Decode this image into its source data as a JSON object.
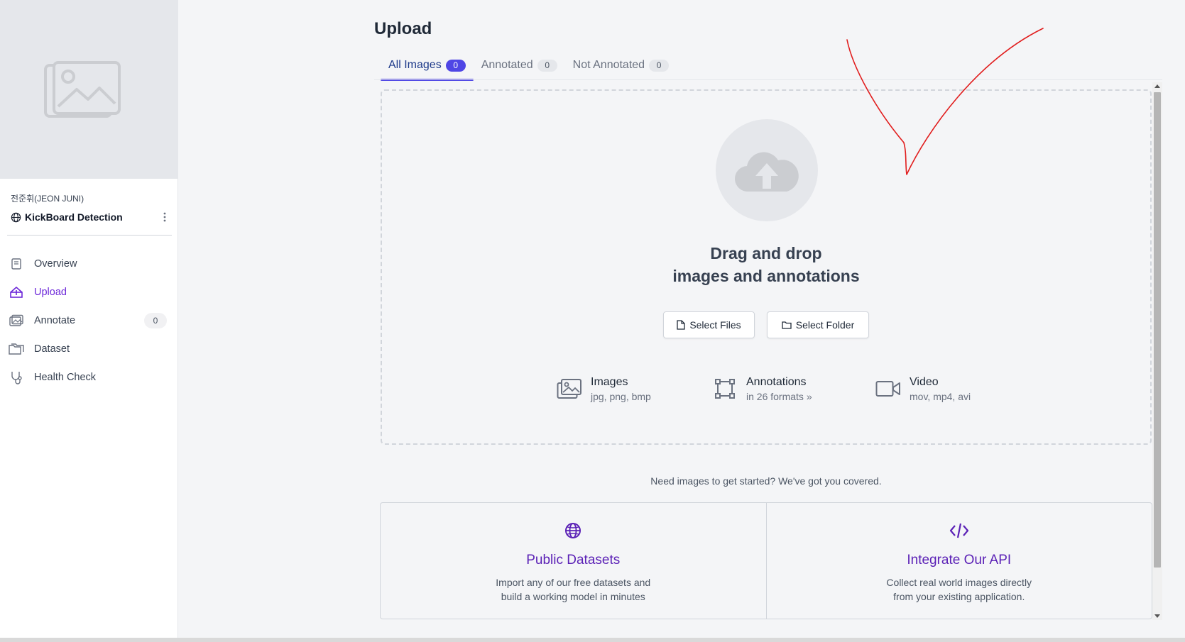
{
  "sidebar": {
    "owner": "전준휘(JEON JUNI)",
    "project_name": "KickBoard Detection",
    "nav": [
      {
        "label": "Overview",
        "icon": "book-icon"
      },
      {
        "label": "Upload",
        "icon": "upload-icon",
        "active": true
      },
      {
        "label": "Annotate",
        "icon": "images-icon",
        "badge": "0"
      },
      {
        "label": "Dataset",
        "icon": "folder-icon"
      },
      {
        "label": "Health Check",
        "icon": "stethoscope-icon"
      }
    ]
  },
  "main": {
    "title": "Upload",
    "tabs": [
      {
        "label": "All Images",
        "count": "0",
        "active": true
      },
      {
        "label": "Annotated",
        "count": "0"
      },
      {
        "label": "Not Annotated",
        "count": "0"
      }
    ],
    "dropzone": {
      "title_line1": "Drag and drop",
      "title_line2": "images and annotations",
      "select_files": "Select Files",
      "select_folder": "Select Folder",
      "formats": [
        {
          "name": "Images",
          "desc": "jpg, png, bmp"
        },
        {
          "name": "Annotations",
          "desc": "in 26 formats »"
        },
        {
          "name": "Video",
          "desc": "mov, mp4, avi"
        }
      ]
    },
    "hint": "Need images to get started? We've got you covered.",
    "cards": [
      {
        "title": "Public Datasets",
        "desc_line1": "Import any of our free datasets and",
        "desc_line2": "build a working model in minutes"
      },
      {
        "title": "Integrate Our API",
        "desc_line1": "Collect real world images directly",
        "desc_line2": "from your existing application."
      }
    ]
  },
  "colors": {
    "accent": "#4f46e5",
    "purple": "#6d28d9",
    "annotation_mark": "#e11d1d"
  }
}
